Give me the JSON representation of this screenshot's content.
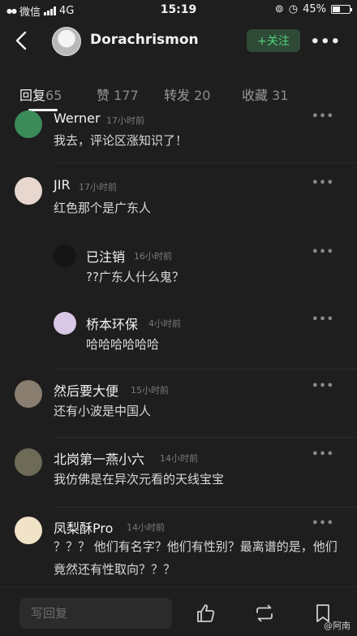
{
  "status_bar": {
    "carrier": "微信",
    "network": "4G",
    "time": "15:19",
    "battery": "45%",
    "battery_level": 0.45
  },
  "header": {
    "name": "Dorachrismon",
    "follow_label": "+关注",
    "more_label": "•••"
  },
  "tabs": [
    {
      "label": "回复",
      "count": "65"
    },
    {
      "label": "赞",
      "count": "177"
    },
    {
      "label": "转发",
      "count": "20"
    },
    {
      "label": "收藏",
      "count": "31"
    }
  ],
  "comments": [
    {
      "name": "Werner",
      "time": "17小时前",
      "text": "我去，评论区涨知识了！",
      "avatar_color": "#3b8c5a"
    },
    {
      "name": "JIR",
      "time": "17小时前",
      "text": "红色那个是广东人",
      "avatar_color": "#e8d7cf"
    },
    {
      "name": "已注销",
      "time": "16小时前",
      "text": "??广东人什么鬼？",
      "avatar_color": "#151515"
    },
    {
      "name": "桥本环保",
      "time": "4小时前",
      "text": "哈哈哈哈哈哈",
      "avatar_color": "#d9c7e6"
    },
    {
      "name": "然后要大便",
      "time": "15小时前",
      "text": "还有小波是中国人",
      "avatar_color": "#8a7e70"
    },
    {
      "name": "北岗第一燕小六",
      "time": "14小时前",
      "text": "我仿佛是在异次元看的天线宝宝",
      "avatar_color": "#6e6a58"
    },
    {
      "name": "凤梨酥Pro",
      "time": "14小时前",
      "text": "？？？ 他们有名字？他们有性别？最离谱的是，他们竟然还有性取向？？？",
      "avatar_color": "#f1e3c8"
    }
  ],
  "comment_more_label": "•••",
  "bottom_bar": {
    "reply_placeholder": "写回复",
    "watermark": "@阿南"
  }
}
